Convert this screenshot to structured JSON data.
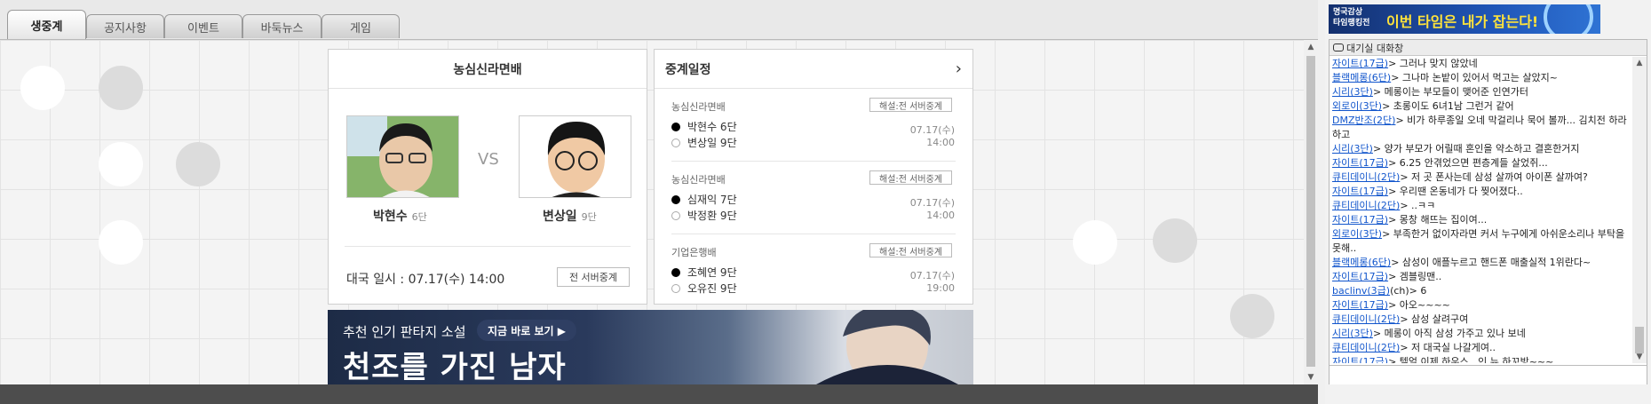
{
  "tabs": [
    {
      "label": "생중계",
      "active": true
    },
    {
      "label": "공지사항",
      "active": false
    },
    {
      "label": "이벤트",
      "active": false
    },
    {
      "label": "바둑뉴스",
      "active": false
    },
    {
      "label": "게임",
      "active": false
    }
  ],
  "match": {
    "title": "농심신라면배",
    "vs": "VS",
    "player1": {
      "name": "박현수",
      "rank": "6단"
    },
    "player2": {
      "name": "변상일",
      "rank": "9단"
    },
    "date": "대국 일시 : 07.17(수) 14:00",
    "all_server_button": "전 서버중계"
  },
  "schedule": {
    "title": "중계일정",
    "entries": [
      {
        "title": "농심신라면배",
        "button": "해설:전 서버중계",
        "black": "박현수 6단",
        "white": "변상일 9단",
        "date": "07.17(수)",
        "time": "14:00"
      },
      {
        "title": "농심신라면배",
        "button": "해설:전 서버중계",
        "black": "심재익 7단",
        "white": "박정환 9단",
        "date": "07.17(수)",
        "time": "14:00"
      },
      {
        "title": "기업은행배",
        "button": "해설:전 서버중계",
        "black": "조혜연 9단",
        "white": "오유진 9단",
        "date": "07.17(수)",
        "time": "19:00"
      }
    ]
  },
  "banner": {
    "subtitle": "추천 인기 판타지 소설",
    "cta": "지금 바로 보기 ▶",
    "headline": "천조를 가진 남자"
  },
  "ad": {
    "line1": "명국감상",
    "line2": "타임랭킹전",
    "headline": "이번 타임은 내가 잡는다!"
  },
  "chat": {
    "title": "대기실 대화창",
    "messages": [
      {
        "nick": "자이트(17급)",
        "text": "> 그러나 맞지 않았네"
      },
      {
        "nick": "블랙메롱(6단)",
        "text": "> 그나마 논밭이 있어서 먹고는 살았지~"
      },
      {
        "nick": "시리(3단)",
        "text": "> 메롱이는 부모들이 맺어준 인연가터"
      },
      {
        "nick": "외로이(3단)",
        "text": "> 초롱이도 6녀1남 그런거 같어"
      },
      {
        "nick": "DMZ반조(2단)",
        "text": "> 비가 하루종일 오네 막걸리나 묵어 볼까... 김치전 하라 하고"
      },
      {
        "nick": "시리(3단)",
        "text": "> 양가 부모가 어릴때 혼인을 약소하고 결혼한거지"
      },
      {
        "nick": "자이트(17급)",
        "text": "> 6.25 안겪었으면 편층계들 살었쥐..."
      },
      {
        "nick": "큐티데이니(2단)",
        "text": "> 저 곳 폰사는데 삼성 살까여 아이폰 살까여?"
      },
      {
        "nick": "자이트(17급)",
        "text": "> 우리땐 온동네가 다 찢어졌다.."
      },
      {
        "nick": "큐티데이니(2단)",
        "text": "> ..ㅋㅋ"
      },
      {
        "nick": "자이트(17급)",
        "text": "> 몽창 해뜨는 집이여..."
      },
      {
        "nick": "외로이(3단)",
        "text": "> 부족한거 없이자라면 커서 누구에게 아쉬운소리나 부탁을 못해.."
      },
      {
        "nick": "블랙메롱(6단)",
        "text": "> 삼성이 애플누르고 핸드폰 매출실적 1위란다~"
      },
      {
        "nick": "자이트(17급)",
        "text": "> 겜블링맨.."
      },
      {
        "nick": "baclinv(3급)",
        "text": "(ch)> 6"
      },
      {
        "nick": "자이트(17급)",
        "text": "> 아오~~~~"
      },
      {
        "nick": "큐티데이니(2단)",
        "text": "> 삼성 살려구여"
      },
      {
        "nick": "시리(3단)",
        "text": "> 메롱이 아직 삼성 가주고 있나 보네"
      },
      {
        "nick": "큐티데이니(2단)",
        "text": "> 저 대국실 나갈게여.."
      },
      {
        "nick": "자이트(17급)",
        "text": "> 텔얼 이제 하우스.. 인 뉴 하꼬방~~~..."
      }
    ]
  },
  "colors": {
    "nick_link": "#1155cc",
    "footer": "#4d4d4d",
    "ad_accent": "#ffe33a"
  }
}
